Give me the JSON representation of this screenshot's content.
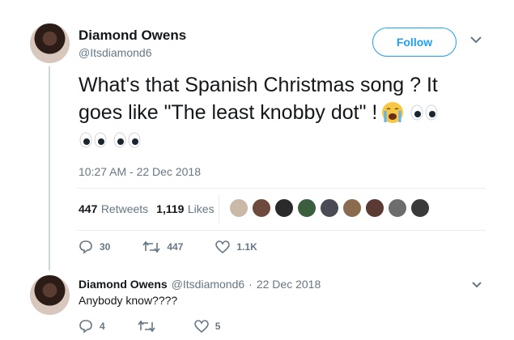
{
  "tweet": {
    "author_name": "Diamond Owens",
    "author_handle": "@Itsdiamond6",
    "follow_label": "Follow",
    "text_line1": "What's that Spanish Christmas song ? It",
    "text_line2": "goes like \"The least knobby dot\" !",
    "timestamp": "10:27 AM - 22 Dec 2018",
    "retweets_count": "447",
    "retweets_label": "Retweets",
    "likes_count": "1,119",
    "likes_label": "Likes",
    "reply_count": "30",
    "retweet_count": "447",
    "like_count": "1.1K"
  },
  "reply": {
    "author_name": "Diamond Owens",
    "author_handle": "@Itsdiamond6",
    "separator": "·",
    "date": "22 Dec 2018",
    "text": "Anybody know????",
    "reply_count": "4",
    "retweet_count": "",
    "like_count": "5"
  },
  "colors": {
    "accent": "#1da1f2",
    "text": "#14171a",
    "muted": "#657786",
    "divider": "#e6ecf0"
  },
  "icons": [
    "avatar-photo",
    "chevron-down-icon",
    "crying-face-emoji",
    "eyes-emoji",
    "reply-icon",
    "retweet-icon",
    "heart-icon"
  ]
}
